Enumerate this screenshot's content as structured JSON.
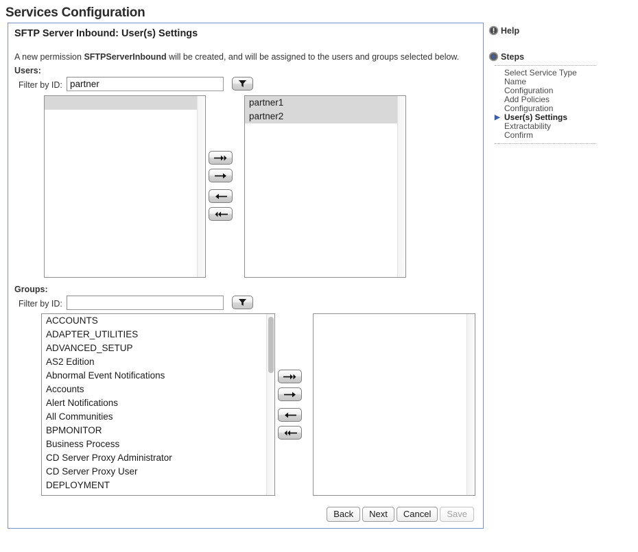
{
  "page": {
    "title": "Services Configuration"
  },
  "panel": {
    "title": "SFTP Server Inbound: User(s) Settings",
    "description_prefix": "A new permission ",
    "description_bold": "SFTPServerInbound",
    "description_suffix": " will be created, and will be assigned to the users and groups selected below."
  },
  "users": {
    "section_label": "Users:",
    "filter_label": "Filter by ID:",
    "filter_value": "partner",
    "filter_placeholder": "",
    "filter_button_icon": "filter-funnel-icon",
    "available": [
      {
        "label": "",
        "selected": true
      }
    ],
    "assigned": [
      {
        "label": "partner1",
        "selected": true
      },
      {
        "label": "partner2",
        "selected": true
      }
    ],
    "transfer_buttons": [
      {
        "name": "move-all-right",
        "icon": "double-arrow-right-icon"
      },
      {
        "name": "move-right",
        "icon": "arrow-right-icon"
      },
      {
        "name": "move-left",
        "icon": "arrow-left-icon"
      },
      {
        "name": "move-all-left",
        "icon": "double-arrow-left-icon"
      }
    ]
  },
  "groups": {
    "section_label": "Groups:",
    "filter_label": "Filter by ID:",
    "filter_value": "",
    "filter_placeholder": "",
    "filter_button_icon": "filter-funnel-icon",
    "available": [
      {
        "label": "ACCOUNTS",
        "selected": false
      },
      {
        "label": "ADAPTER_UTILITIES",
        "selected": false
      },
      {
        "label": "ADVANCED_SETUP",
        "selected": false
      },
      {
        "label": "AS2 Edition",
        "selected": false
      },
      {
        "label": "Abnormal Event Notifications",
        "selected": false
      },
      {
        "label": "Accounts",
        "selected": false
      },
      {
        "label": "Alert Notifications",
        "selected": false
      },
      {
        "label": "All Communities",
        "selected": false
      },
      {
        "label": "BPMONITOR",
        "selected": false
      },
      {
        "label": "Business Process",
        "selected": false
      },
      {
        "label": "CD Server Proxy Administrator",
        "selected": false
      },
      {
        "label": "CD Server Proxy User",
        "selected": false
      },
      {
        "label": "DEPLOYMENT",
        "selected": false
      }
    ],
    "assigned": [],
    "transfer_buttons": [
      {
        "name": "move-all-right",
        "icon": "double-arrow-right-icon"
      },
      {
        "name": "move-right",
        "icon": "arrow-right-icon"
      },
      {
        "name": "move-left",
        "icon": "arrow-left-icon"
      },
      {
        "name": "move-all-left",
        "icon": "double-arrow-left-icon"
      }
    ]
  },
  "actions": {
    "back": "Back",
    "next": "Next",
    "cancel": "Cancel",
    "save": "Save",
    "save_disabled": true
  },
  "sidebar": {
    "help_label": "Help",
    "help_icon": "info-exclamation-icon",
    "steps_label": "Steps",
    "steps_icon": "cursor-arrow-icon",
    "steps": [
      {
        "label": "Select Service Type",
        "current": false
      },
      {
        "label": "Name",
        "current": false
      },
      {
        "label": "Configuration",
        "current": false
      },
      {
        "label": "Add Policies",
        "current": false
      },
      {
        "label": "Configuration",
        "current": false
      },
      {
        "label": "User(s) Settings",
        "current": true
      },
      {
        "label": "Extractability",
        "current": false
      },
      {
        "label": "Confirm",
        "current": false
      }
    ]
  },
  "colors": {
    "panel_border": "#7b8fc4",
    "selection": "#d8d8d8",
    "step_marker": "#3a5fb0"
  }
}
